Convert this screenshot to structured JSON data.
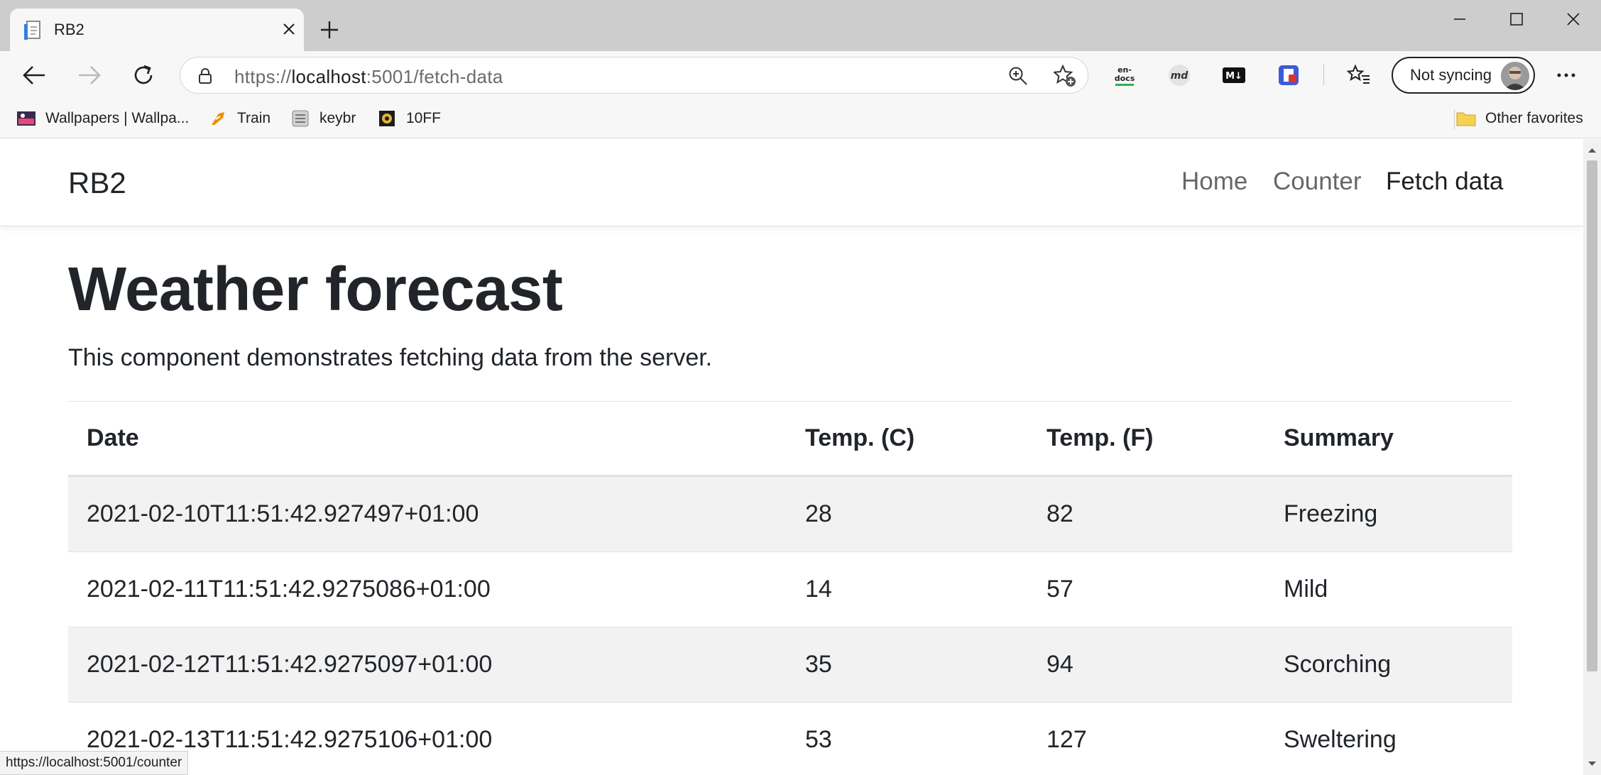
{
  "browser": {
    "tab": {
      "title": "RB2"
    },
    "address": {
      "scheme": "https://",
      "host": "localhost",
      "rest": ":5001/fetch-data"
    },
    "extensions": [
      "en-docs-icon",
      "md-icon",
      "markdown-icon",
      "tab-extension-icon"
    ],
    "extension_labels": {
      "endocs_top": "en-",
      "endocs_bottom": "docs",
      "md": "md",
      "markdown": "M↓"
    },
    "profile": {
      "label": "Not syncing"
    },
    "favorites": [
      {
        "label": "Wallpapers | Wallpa...",
        "icon": "wallpapers-icon"
      },
      {
        "label": "Train",
        "icon": "train-icon"
      },
      {
        "label": "keybr",
        "icon": "keybr-icon"
      },
      {
        "label": "10FF",
        "icon": "10ff-icon"
      }
    ],
    "other_favorites": "Other favorites",
    "status_url": "https://localhost:5001/counter"
  },
  "app": {
    "brand": "RB2",
    "nav": [
      {
        "label": "Home"
      },
      {
        "label": "Counter"
      },
      {
        "label": "Fetch data",
        "active": true
      }
    ],
    "title": "Weather forecast",
    "lead": "This component demonstrates fetching data from the server.",
    "table": {
      "headers": [
        "Date",
        "Temp. (C)",
        "Temp. (F)",
        "Summary"
      ],
      "rows": [
        [
          "2021-02-10T11:51:42.927497+01:00",
          "28",
          "82",
          "Freezing"
        ],
        [
          "2021-02-11T11:51:42.9275086+01:00",
          "14",
          "57",
          "Mild"
        ],
        [
          "2021-02-12T11:51:42.9275097+01:00",
          "35",
          "94",
          "Scorching"
        ],
        [
          "2021-02-13T11:51:42.9275106+01:00",
          "53",
          "127",
          "Sweltering"
        ]
      ]
    }
  },
  "colors": {
    "accent": "#0078d4",
    "text": "#212529",
    "stripe": "#f2f2f2"
  }
}
